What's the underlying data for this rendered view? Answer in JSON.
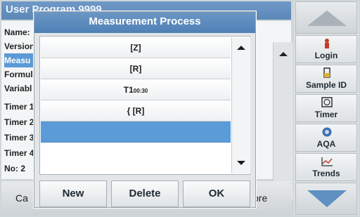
{
  "background": {
    "title": "User Program  9999",
    "rows": [
      "Name:",
      "Version",
      "Measu",
      "Formul",
      "Variabl",
      "Timer 1",
      "Timer 2",
      "Timer 3",
      "Timer 4",
      "No: 2"
    ],
    "selected_row": 2,
    "bottom_left": "Ca",
    "bottom_right": "ore"
  },
  "dialog": {
    "title": "Measurement Process",
    "items": [
      {
        "main": "[Z]",
        "sub": ""
      },
      {
        "main": "[R]",
        "sub": ""
      },
      {
        "main": "T1",
        "sub": "00:30"
      },
      {
        "main": "{ [R]",
        "sub": ""
      },
      {
        "main": "",
        "sub": ""
      },
      {
        "main": "",
        "sub": ""
      }
    ],
    "selected_index": 4,
    "buttons": {
      "new": "New",
      "delete": "Delete",
      "ok": "OK"
    }
  },
  "sidebar": {
    "login": {
      "label": "Login",
      "icon": "person-icon"
    },
    "sample_id": {
      "label": "Sample ID",
      "icon": "sample-icon"
    },
    "timer": {
      "label": "Timer",
      "icon": "timer-icon"
    },
    "aqa": {
      "label": "AQA",
      "icon": "aqa-icon"
    },
    "trends": {
      "label": "Trends",
      "icon": "trends-icon"
    }
  },
  "colors": {
    "title_bar": "#5b87b8",
    "selection": "#5b9bd8",
    "nav_down_arrow": "#5e90c2"
  }
}
